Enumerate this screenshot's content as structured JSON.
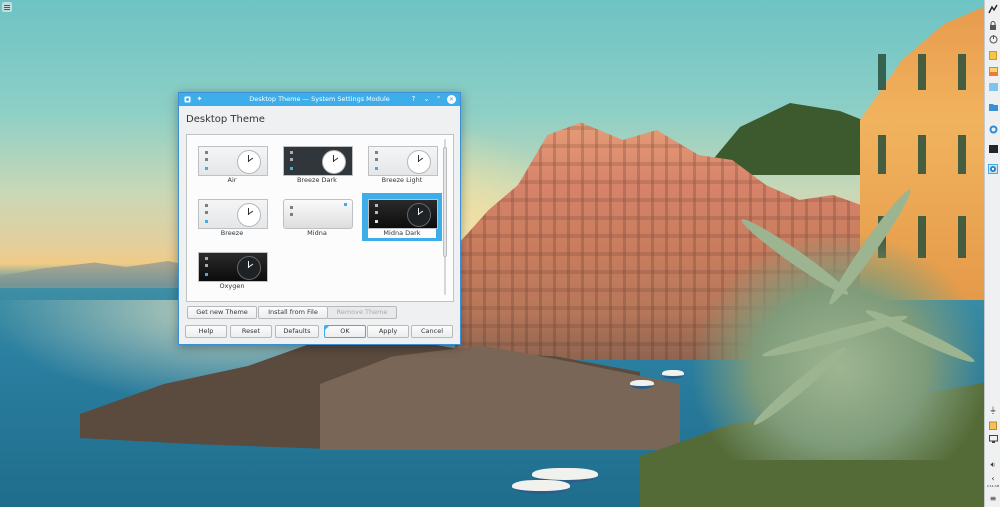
{
  "dialog": {
    "title": "Desktop Theme — System Settings Module",
    "heading": "Desktop Theme",
    "titlebar_buttons": {
      "help": "?",
      "minimize": "⌄",
      "maximize": "⌃",
      "close": "✕"
    },
    "themes": [
      {
        "name": "Air",
        "style": "light",
        "selected": false
      },
      {
        "name": "Breeze Dark",
        "style": "dark",
        "selected": false
      },
      {
        "name": "Breeze Light",
        "style": "light",
        "selected": false
      },
      {
        "name": "Breeze",
        "style": "light",
        "selected": false
      },
      {
        "name": "Midna",
        "style": "midna",
        "selected": false
      },
      {
        "name": "Midna Dark",
        "style": "black",
        "selected": true
      },
      {
        "name": "Oxygen",
        "style": "black",
        "selected": false
      }
    ],
    "theme_actions": {
      "get_new": "Get new Theme",
      "install": "Install from File",
      "remove": "Remove Theme"
    },
    "footer": {
      "help": "Help",
      "reset": "Reset",
      "defaults": "Defaults",
      "ok": "OK",
      "apply": "Apply",
      "cancel": "Cancel"
    }
  },
  "panel": {
    "icons": [
      "plasma-logo-icon",
      "lock-icon",
      "power-icon",
      "notes-icon",
      "image-icon",
      "blue-icon",
      "folder-icon",
      "browser-icon",
      "terminal-icon",
      "settings-icon"
    ],
    "tray_icons": [
      "usb-icon",
      "clipboard-icon",
      "display-icon",
      "volume-icon",
      "chevron-left-icon"
    ],
    "clock": "2:14 AM"
  },
  "colors": {
    "accent": "#3daee9",
    "window_bg": "#eff0f1",
    "text": "#31363b"
  }
}
